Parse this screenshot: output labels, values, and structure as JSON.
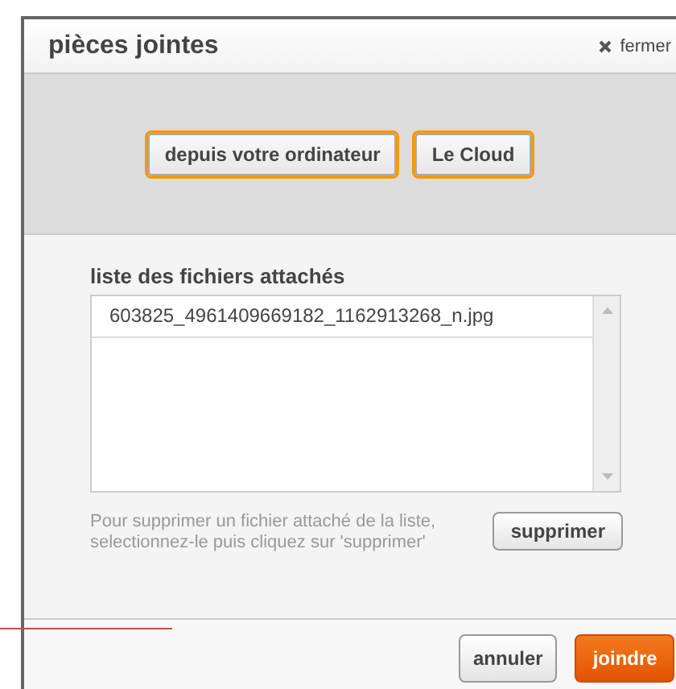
{
  "dialog": {
    "title": "pièces jointes",
    "close_label": "fermer"
  },
  "sources": [
    {
      "label": "depuis votre ordinateur"
    },
    {
      "label": "Le Cloud"
    }
  ],
  "file_list": {
    "label": "liste des fichiers attachés",
    "files": [
      {
        "name": "603825_4961409669182_1162913268_n.jpg",
        "selected": false
      }
    ]
  },
  "help_text": "Pour supprimer un fichier attaché de la liste, selectionnez-le puis cliquez sur 'supprimer'",
  "delete_button": "supprimer",
  "buttons": [
    {
      "label": "annuler",
      "kind": "secondary"
    },
    {
      "label": "joindre",
      "kind": "primary"
    }
  ]
}
